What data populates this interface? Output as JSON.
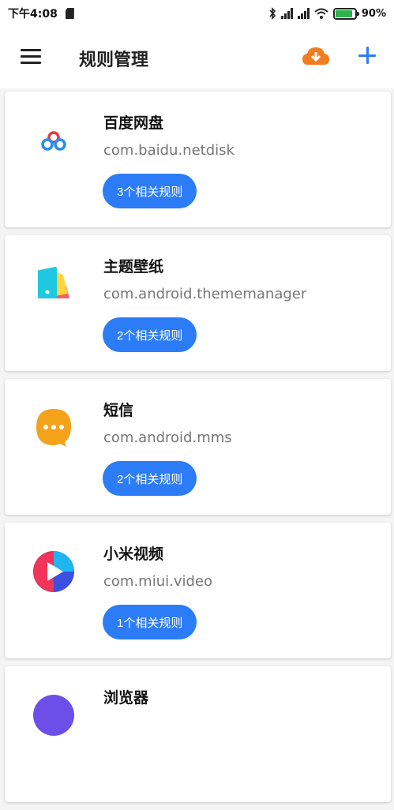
{
  "status_bar": {
    "time": "下午4:08",
    "battery_percent": "90%",
    "battery_level": 0.9,
    "icons": [
      "sd-card-icon",
      "bluetooth-icon",
      "signal-icon",
      "signal-icon",
      "wifi-icon",
      "battery-icon"
    ]
  },
  "app_bar": {
    "title": "规则管理",
    "menu_icon": "hamburger-menu-icon",
    "cloud_icon": "cloud-download-icon",
    "add_icon": "plus-icon"
  },
  "colors": {
    "accent": "#2b7cf6",
    "cloud": "#f27c20",
    "background": "#f4f4f4"
  },
  "apps": [
    {
      "name": "百度网盘",
      "package": "com.baidu.netdisk",
      "rules_label": "3个相关规则",
      "icon": "baidu-netdisk-icon"
    },
    {
      "name": "主题壁纸",
      "package": "com.android.thememanager",
      "rules_label": "2个相关规则",
      "icon": "theme-manager-icon"
    },
    {
      "name": "短信",
      "package": "com.android.mms",
      "rules_label": "2个相关规则",
      "icon": "messages-icon"
    },
    {
      "name": "小米视频",
      "package": "com.miui.video",
      "rules_label": "1个相关规则",
      "icon": "mi-video-icon"
    },
    {
      "name": "浏览器",
      "package": "",
      "rules_label": "",
      "icon": "browser-icon"
    }
  ]
}
